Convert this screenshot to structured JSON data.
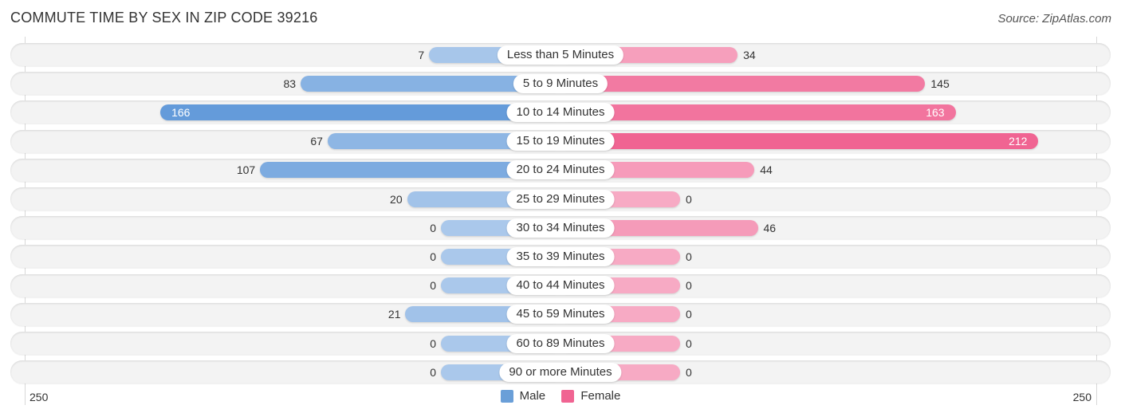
{
  "title": "COMMUTE TIME BY SEX IN ZIP CODE 39216",
  "source": "Source: ZipAtlas.com",
  "chart_data": {
    "type": "bar",
    "orientation": "horizontal-diverging",
    "title": "COMMUTE TIME BY SEX IN ZIP CODE 39216",
    "categories": [
      "Less than 5 Minutes",
      "5 to 9 Minutes",
      "10 to 14 Minutes",
      "15 to 19 Minutes",
      "20 to 24 Minutes",
      "25 to 29 Minutes",
      "30 to 34 Minutes",
      "35 to 39 Minutes",
      "40 to 44 Minutes",
      "45 to 59 Minutes",
      "60 to 89 Minutes",
      "90 or more Minutes"
    ],
    "series": [
      {
        "name": "Male",
        "color": "#6a9fd8",
        "values": [
          7,
          83,
          166,
          67,
          107,
          20,
          0,
          0,
          0,
          21,
          0,
          0
        ]
      },
      {
        "name": "Female",
        "color": "#f06492",
        "values": [
          34,
          145,
          163,
          212,
          44,
          0,
          46,
          0,
          0,
          0,
          0,
          0
        ]
      }
    ],
    "axis": {
      "left_label": "250",
      "right_label": "250",
      "range": [
        -250,
        250
      ]
    },
    "legend": {
      "position": "bottom-center",
      "entries": [
        "Male",
        "Female"
      ]
    }
  }
}
